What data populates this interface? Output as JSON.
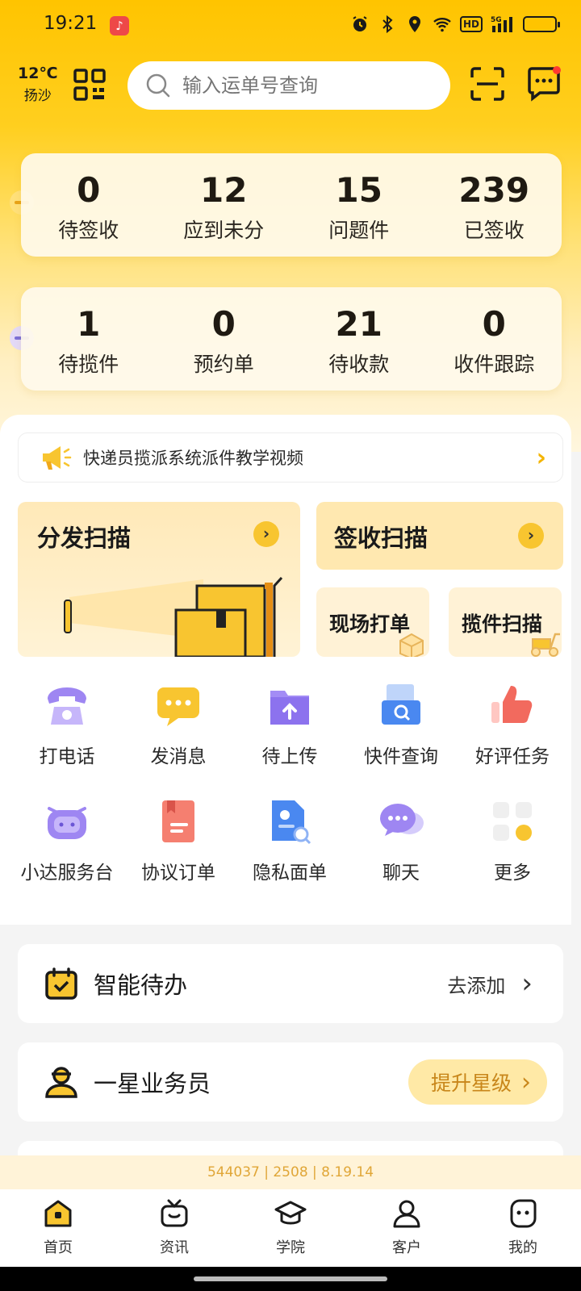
{
  "status_bar": {
    "time": "19:21",
    "hd": "HD",
    "signal": "5G",
    "battery_level": 0.9
  },
  "header": {
    "temperature": "12℃",
    "city": "扬沙",
    "search_placeholder": "输入运单号查询"
  },
  "stats_row1": [
    {
      "value": "0",
      "label": "待签收"
    },
    {
      "value": "12",
      "label": "应到未分"
    },
    {
      "value": "15",
      "label": "问题件"
    },
    {
      "value": "239",
      "label": "已签收"
    }
  ],
  "stats_row2": [
    {
      "value": "1",
      "label": "待揽件"
    },
    {
      "value": "0",
      "label": "预约单"
    },
    {
      "value": "21",
      "label": "待收款"
    },
    {
      "value": "0",
      "label": "收件跟踪"
    }
  ],
  "notice": {
    "text": "快递员揽派系统派件教学视频"
  },
  "scan_cards": {
    "dispatch": "分发扫描",
    "signoff": "签收扫描",
    "onsite_print": "现场打单",
    "pickup_scan": "揽件扫描"
  },
  "tools_row1": [
    {
      "label": "打电话",
      "icon": "phone-icon"
    },
    {
      "label": "发消息",
      "icon": "message-icon"
    },
    {
      "label": "待上传",
      "icon": "upload-folder-icon"
    },
    {
      "label": "快件查询",
      "icon": "parcel-search-icon"
    },
    {
      "label": "好评任务",
      "icon": "thumbs-up-icon"
    }
  ],
  "tools_row2": [
    {
      "label": "小达服务台",
      "icon": "robot-icon"
    },
    {
      "label": "协议订单",
      "icon": "contract-icon"
    },
    {
      "label": "隐私面单",
      "icon": "privacy-doc-icon"
    },
    {
      "label": "聊天",
      "icon": "chat-icon"
    },
    {
      "label": "更多",
      "icon": "more-grid-icon"
    }
  ],
  "smart_todo": {
    "title": "智能待办",
    "action": "去添加"
  },
  "star_level": {
    "title": "一星业务员",
    "action": "提升星级"
  },
  "version": "544037 | 2508 | 8.19.14",
  "tabs": [
    {
      "label": "首页",
      "icon": "home-icon",
      "active": true
    },
    {
      "label": "资讯",
      "icon": "tv-icon",
      "active": false
    },
    {
      "label": "学院",
      "icon": "graduation-cap-icon",
      "active": false
    },
    {
      "label": "客户",
      "icon": "person-icon",
      "active": false
    },
    {
      "label": "我的",
      "icon": "face-icon",
      "active": false
    }
  ],
  "colors": {
    "brand_yellow": "#FFC400",
    "accent_orange": "#F4B400",
    "stat_text": "#1f1a12"
  }
}
